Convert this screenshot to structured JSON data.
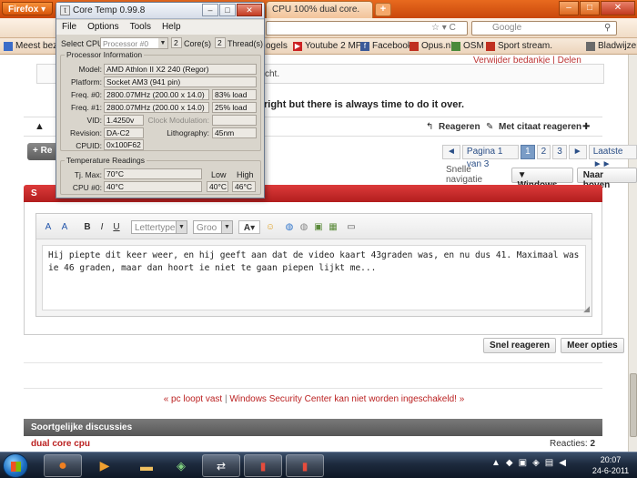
{
  "firefox": {
    "menu_label": "Firefox",
    "tab_title": "CPU 100% dual core.",
    "newtab": "+",
    "search_placeholder": "Google",
    "search_engine_icon": "G",
    "winctl": {
      "min": "–",
      "max": "□",
      "close": "✕"
    }
  },
  "bookmarks": [
    {
      "label": "Meest bezo",
      "icon_color": "#3b6cc8"
    },
    {
      "label": "ogels",
      "icon_color": "#dd4422"
    },
    {
      "label": "Youtube 2 MP3",
      "icon_color": "#cc2222"
    },
    {
      "label": "Facebook",
      "icon_color": "#3b5998"
    },
    {
      "label": "Opus.nl",
      "icon_color": "#c03020"
    },
    {
      "label": "OSM",
      "icon_color": "#4a8a3a"
    },
    {
      "label": "Sport stream.",
      "icon_color": "#c03020"
    },
    {
      "label": "Bladwijzers",
      "icon_color": "#6a6a6a"
    }
  ],
  "page": {
    "top_links": "Verwijder bedankje  |  Delen",
    "note_text": "cht.",
    "bold_line": "right but there is always time to do it over.",
    "actions": {
      "reply": "Reageren",
      "quote_reply": "Met citaat reageren"
    },
    "reply_button": "+ Re",
    "pager": {
      "prev": "◄",
      "label": "Pagina 1 van 3",
      "pages": [
        "1",
        "2",
        "3"
      ],
      "next": "►",
      "last": "Laatste ►►"
    },
    "quicknav": {
      "label": "Snelle navigatie",
      "windows": "▼ Windows",
      "up": "Naar boven"
    },
    "editor_header": "S",
    "editor": {
      "font_placeholder": "Lettertype",
      "size_placeholder": "Groo",
      "text": "Hij piepte dit keer weer, en hij geeft aan dat de video kaart 43graden was, en nu dus 41. Maximaal was ie 46 graden, maar dan hoort ie niet te gaan piepen lijkt me..."
    },
    "buttons": {
      "quick_reply": "Snel reageren",
      "more_options": "Meer opties"
    },
    "prevnext": {
      "prev": "« pc loopt vast",
      "next": "Windows Security Center kan niet worden ingeschakeld! »"
    },
    "similar": {
      "header": "Soortgelijke discussies",
      "title": "dual core cpu",
      "reactions_label": "Reacties:",
      "reactions_count": "2"
    }
  },
  "coretemp": {
    "title": "Core Temp 0.99.8",
    "menu": [
      "File",
      "Options",
      "Tools",
      "Help"
    ],
    "select_cpu_label": "Select CPU:",
    "select_cpu_value": "Processor #0",
    "cores_value": "2",
    "cores_label": "Core(s)",
    "threads_value": "2",
    "threads_label": "Thread(s)",
    "processor_info_label": "Processor Information",
    "model_label": "Model:",
    "model_value": "AMD Athlon II X2 240 (Regor)",
    "platform_label": "Platform:",
    "platform_value": "Socket AM3 (941 pin)",
    "freq0_label": "Freq. #0:",
    "freq0_value": "2800.07MHz (200.00 x 14.0)",
    "freq0_load": "83% load",
    "freq1_label": "Freq. #1:",
    "freq1_value": "2800.07MHz (200.00 x 14.0)",
    "freq1_load": "25% load",
    "vid_label": "VID:",
    "vid_value": "1.4250v",
    "clockmod_label": "Clock Modulation:",
    "revision_label": "Revision:",
    "revision_value": "DA-C2",
    "lithography_label": "Lithography:",
    "lithography_value": "45nm",
    "cpuid_label": "CPUID:",
    "cpuid_value": "0x100F62",
    "temp_readings_label": "Temperature Readings",
    "tjmax_label": "Tj. Max:",
    "tjmax_value": "70°C",
    "low_label": "Low",
    "high_label": "High",
    "cpu0_label": "CPU #0:",
    "cpu0_value": "40°C",
    "cpu0_low": "40°C",
    "cpu0_high": "46°C"
  },
  "taskbar": {
    "time": "20:07",
    "date": "24-6-2011"
  }
}
